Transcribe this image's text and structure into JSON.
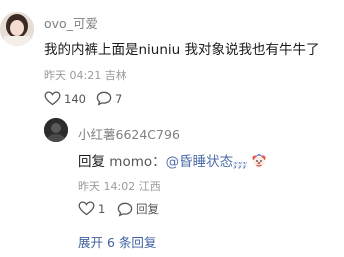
{
  "main_comment": {
    "username": "ovo_可爱",
    "text": "我的内裤上面是niuniu 我对象说我也有牛牛了",
    "time": "昨天 04:21",
    "location": "吉林",
    "like_count": "140",
    "reply_count": "7"
  },
  "reply": {
    "username": "小红薯6624C796",
    "prefix": "回复",
    "target": "momo",
    "separator": "：",
    "mention": "@昏睡状态",
    "mention_suffix": "𝓏𝓏𝓏",
    "time": "昨天 14:02",
    "location": "江西",
    "like_count": "1",
    "reply_label": "回复"
  },
  "expand_label": "展开 6 条回复",
  "icons": {
    "like": "heart-outline-icon",
    "comment": "speech-bubble-icon",
    "emoji": "clown-face-emoji"
  },
  "colors": {
    "mention": "#4d6ea8",
    "expand": "#3d5fa0",
    "meta": "#9a9a9a"
  }
}
